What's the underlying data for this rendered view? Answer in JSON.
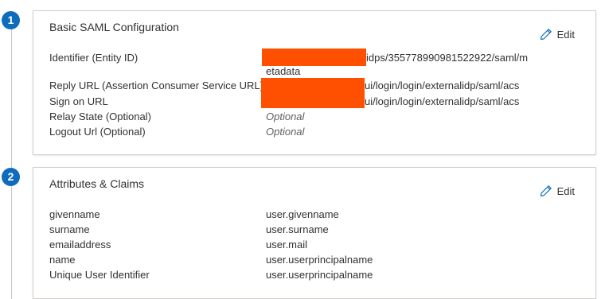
{
  "steps": [
    "1",
    "2"
  ],
  "saml_card": {
    "title": "Basic SAML Configuration",
    "edit_label": "Edit",
    "rows": [
      {
        "label": "Identifier (Entity ID)",
        "value_line1": "idps/3557789909815229​22/saml/m",
        "value_line2": "etadata",
        "redacted": true
      },
      {
        "label": "Reply URL (Assertion Consumer Service URL)",
        "value": "ui/login/login/externalidp/saml/acs",
        "redacted": true
      },
      {
        "label": "Sign on URL",
        "value": "ui/login/login/externalidp/saml/acs",
        "redacted": true
      },
      {
        "label": "Relay State (Optional)",
        "value": "Optional",
        "placeholder": true
      },
      {
        "label": "Logout Url (Optional)",
        "value": "Optional",
        "placeholder": true
      }
    ]
  },
  "claims_card": {
    "title": "Attributes & Claims",
    "edit_label": "Edit",
    "rows": [
      {
        "label": "givenname",
        "value": "user.givenname"
      },
      {
        "label": "surname",
        "value": "user.surname"
      },
      {
        "label": "emailaddress",
        "value": "user.mail"
      },
      {
        "label": "name",
        "value": "user.userprincipalname"
      },
      {
        "label": "Unique User Identifier",
        "value": "user.userprincipalname"
      }
    ]
  },
  "colors": {
    "step_badge": "#0f6cbd",
    "redaction": "#fe5000",
    "edit_icon": "#0f6cbd"
  },
  "icons": {
    "edit": "pencil-icon"
  }
}
